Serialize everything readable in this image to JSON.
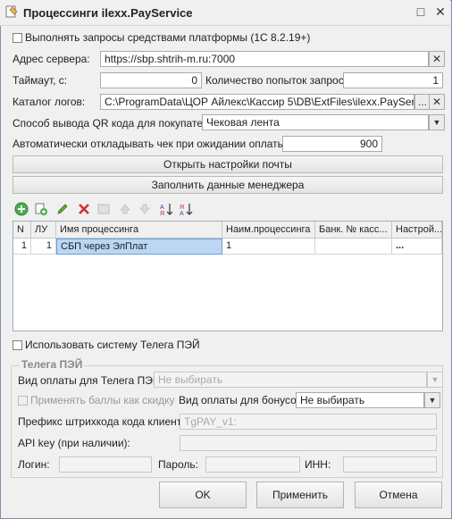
{
  "window": {
    "title": "Процессинги ilexx.PayService",
    "minimize": "□",
    "close": "✕"
  },
  "form": {
    "use_platform_checkbox": "Выполнять запросы средствами платформы (1С 8.2.19+)",
    "server_label": "Адрес сервера:",
    "server_value": "https://sbp.shtrih-m.ru:7000",
    "timeout_label": "Таймаут, с:",
    "timeout_value": "0",
    "attempts_label": "Количество попыток запроса:",
    "attempts_value": "1",
    "logs_label": "Каталог логов:",
    "logs_value": "C:\\ProgramData\\ЦОР Айлекс\\Кассир 5\\DB\\ExtFiles\\ilexx.PayService\\L",
    "qr_label": "Способ вывода QR кода для покупателя:",
    "qr_value": "Чековая лента",
    "defer_label": "Автоматически откладывать чек при ожидании оплаты, с.:",
    "defer_value": "900",
    "open_mail_button": "Открыть настройки почты",
    "fill_manager_button": "Заполнить данные менеджера"
  },
  "grid": {
    "columns": [
      "N",
      "ЛУ",
      "Имя процессинга",
      "Наим.процессинга",
      "Банк. № касс...",
      "Настрой..."
    ],
    "rows": [
      {
        "n": "1",
        "lu": "1",
        "name": "СБП через ЭлПлат",
        "proc_name": "1",
        "bank_no": "",
        "settings": "..."
      }
    ]
  },
  "telega": {
    "use_checkbox": "Использовать систему Телега ПЭЙ",
    "group_title": "Телега ПЭЙ",
    "pay_type_label": "Вид оплаты для Телега ПЭЙ:",
    "pay_type_value": "Не выбирать",
    "apply_bonus_checkbox": "Применять баллы как скидку",
    "bonus_pay_label": "Вид оплаты для бонусов:",
    "bonus_pay_value": "Не выбирать",
    "prefix_label": "Префикс штрихкода кода клиента:",
    "prefix_value": "TgPAY_v1:",
    "api_label": "API key (при наличии):",
    "login_label": "Логин:",
    "password_label": "Пароль:",
    "inn_label": "ИНН:"
  },
  "buttons": {
    "ok": "OK",
    "apply": "Применить",
    "cancel": "Отмена"
  },
  "icons": {
    "clear": "✕",
    "ellipsis": "...",
    "dropdown": "▼"
  }
}
